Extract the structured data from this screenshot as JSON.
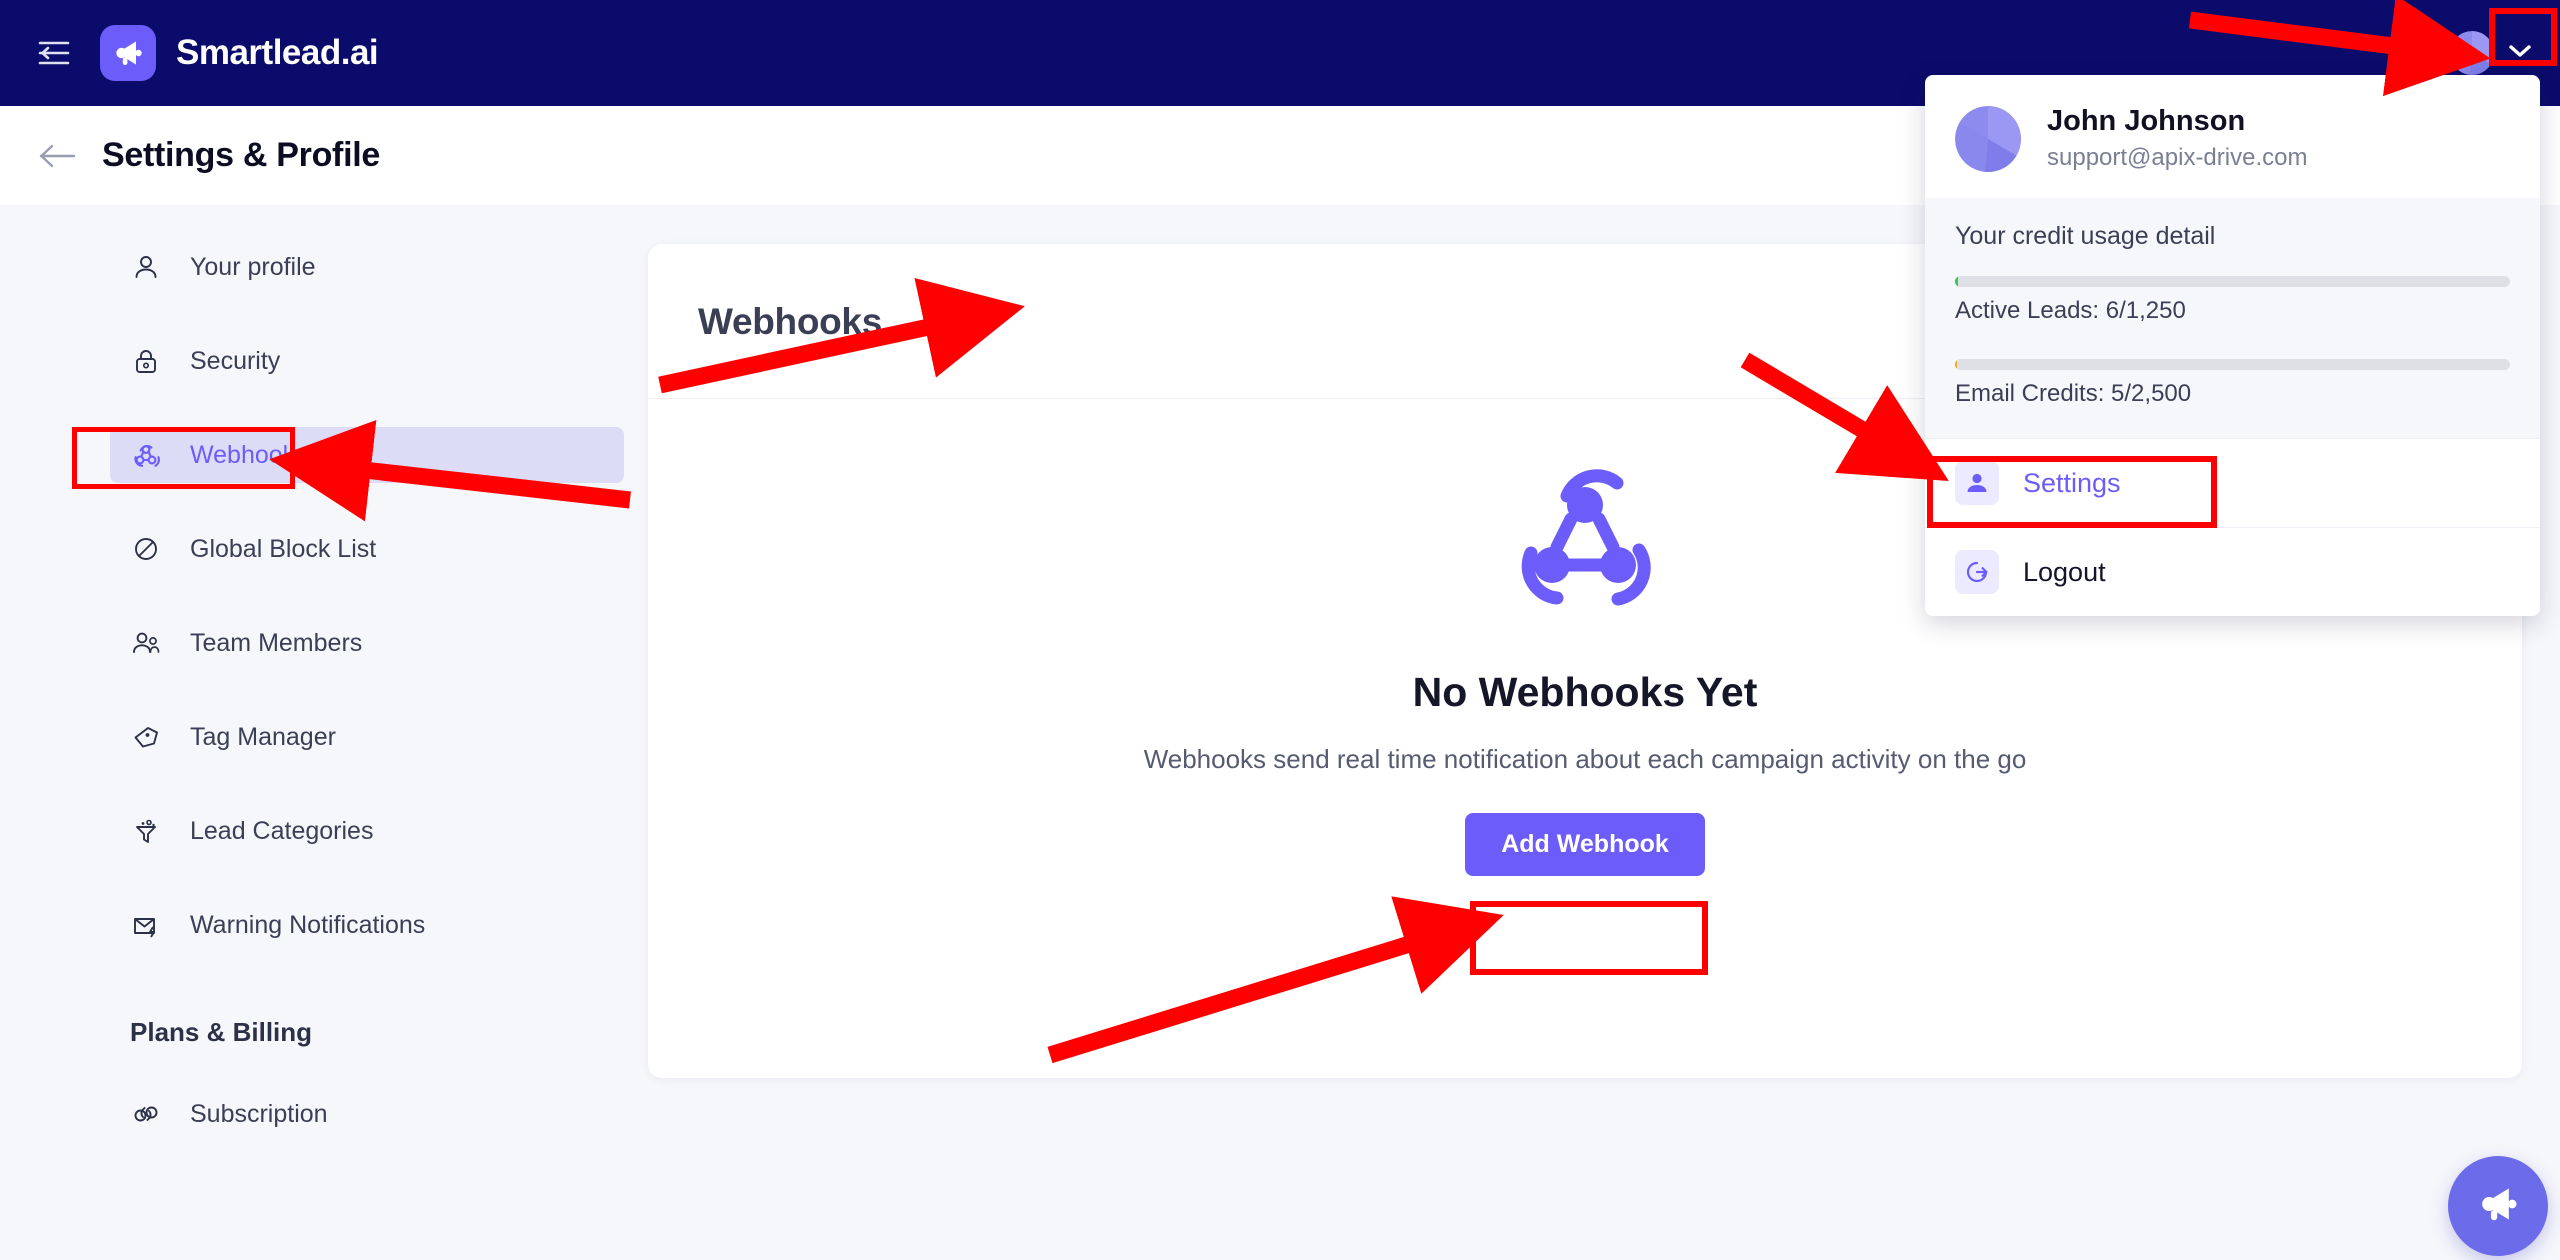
{
  "app": {
    "brand_name": "Smartlead.ai",
    "brand_icon": "megaphone-icon",
    "menu_icon": "hamburger-menu-icon",
    "avatar_icon": "user-avatar",
    "chevron_icon": "chevron-down-icon"
  },
  "page": {
    "back_icon": "arrow-left-icon",
    "title": "Settings & Profile"
  },
  "sidebar": {
    "items": [
      {
        "label": "Your profile",
        "icon": "user-icon",
        "active": false
      },
      {
        "label": "Security",
        "icon": "lock-icon",
        "active": false
      },
      {
        "label": "Webhook",
        "icon": "webhook-icon",
        "active": true
      },
      {
        "label": "Global Block List",
        "icon": "block-icon",
        "active": false
      },
      {
        "label": "Team Members",
        "icon": "users-icon",
        "active": false
      },
      {
        "label": "Tag Manager",
        "icon": "tag-icon",
        "active": false
      },
      {
        "label": "Lead Categories",
        "icon": "funnel-icon",
        "active": false
      },
      {
        "label": "Warning Notifications",
        "icon": "mail-warning-icon",
        "active": false
      }
    ],
    "group_label": "Plans & Billing",
    "group_items": [
      {
        "label": "Subscription",
        "icon": "link-refresh-icon"
      }
    ]
  },
  "main": {
    "card_title": "Webhooks",
    "illustration_icon": "webhook-logo-icon",
    "empty_title": "No Webhooks Yet",
    "empty_subtitle": "Webhooks send real time notification about each campaign activity on the go",
    "add_button": "Add Webhook"
  },
  "profile_menu": {
    "name": "John Johnson",
    "email": "support@apix-drive.com",
    "credit_title": "Your credit usage detail",
    "meters": [
      {
        "label": "Active Leads: 6/1,250",
        "percent": 0.5,
        "color": "#35c759"
      },
      {
        "label": "Email Credits: 5/2,500",
        "percent": 0.4,
        "color": "#f5a623"
      }
    ],
    "rows": [
      {
        "label": "Settings",
        "icon": "person-settings-icon",
        "accent": true
      },
      {
        "label": "Logout",
        "icon": "logout-icon",
        "accent": false
      }
    ]
  },
  "fab": {
    "icon": "megaphone-icon"
  },
  "colors": {
    "navbar": "#0b0b6b",
    "accent": "#6c5dfb",
    "accent_soft": "#dcdcf7",
    "page_bg": "#f6f7fb",
    "annotation": "#ff0000"
  }
}
